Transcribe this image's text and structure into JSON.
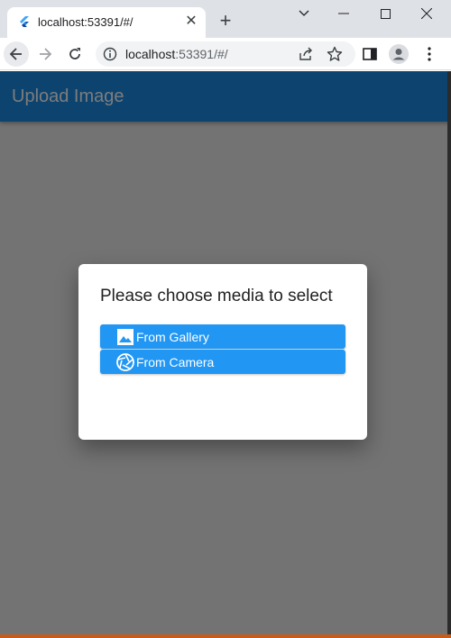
{
  "browser": {
    "tab_title": "localhost:53391/#/",
    "tab_close": "✕",
    "new_tab": "+",
    "url_host": "localhost",
    "url_rest": ":53391/#/"
  },
  "app": {
    "title": "Upload Image",
    "appbar_color": "#0d446f"
  },
  "dialog": {
    "title": "Please choose media to select",
    "buttons": [
      {
        "label": "From Gallery",
        "icon": "image-icon"
      },
      {
        "label": "From Camera",
        "icon": "camera-shutter-icon"
      }
    ],
    "button_color": "#2196f3"
  }
}
